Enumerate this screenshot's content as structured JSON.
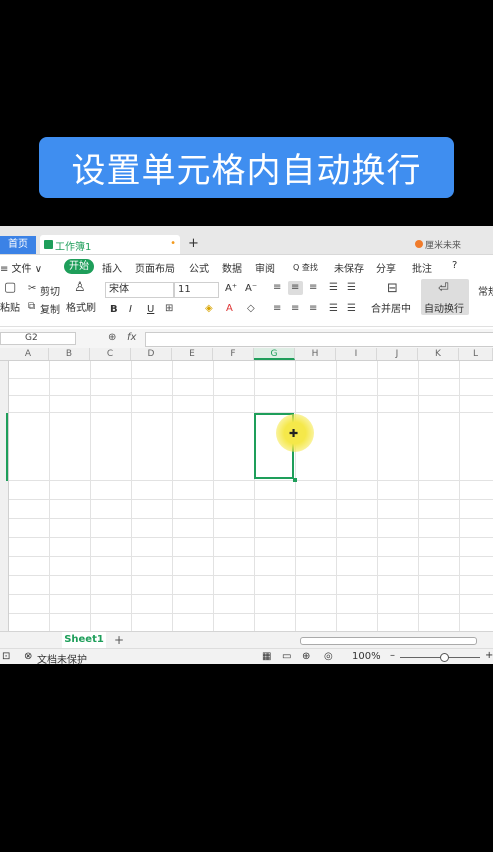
{
  "banner": {
    "title": "设置单元格内自动换行"
  },
  "tabs": {
    "home": "首页",
    "workbook": "工作簿1",
    "workbook_dot": "•",
    "add": "+",
    "user": "厘米未来"
  },
  "menu": {
    "file": "≡ 文件 ∨",
    "items": [
      "开始",
      "插入",
      "页面布局",
      "公式",
      "数据",
      "审阅"
    ],
    "search": "Q 查找",
    "unsaved": "未保存",
    "share": "分享",
    "comment": "批注",
    "help": "?"
  },
  "ribbon": {
    "paste": "粘贴",
    "cut": "剪切",
    "copy": "复制",
    "format_painter": "格式刷",
    "font_name": "宋体",
    "font_size": "11",
    "grow": "A⁺",
    "shrink": "A⁻",
    "bold": "B",
    "italic": "I",
    "underline": "U",
    "merge": "合并居中",
    "wrap": "自动换行",
    "normal": "常规"
  },
  "formula_bar": {
    "name_box": "G2",
    "fx": "fx",
    "value": ""
  },
  "columns": [
    "A",
    "B",
    "C",
    "D",
    "E",
    "F",
    "G",
    "H",
    "I",
    "J",
    "K",
    "L"
  ],
  "sheet": {
    "name": "Sheet1",
    "add": "+"
  },
  "status": {
    "protect": "文档未保护",
    "zoom": "100%"
  },
  "colors": {
    "accent": "#1e9e5a",
    "banner": "#3f8ef0",
    "home_tab": "#3b82e6"
  }
}
